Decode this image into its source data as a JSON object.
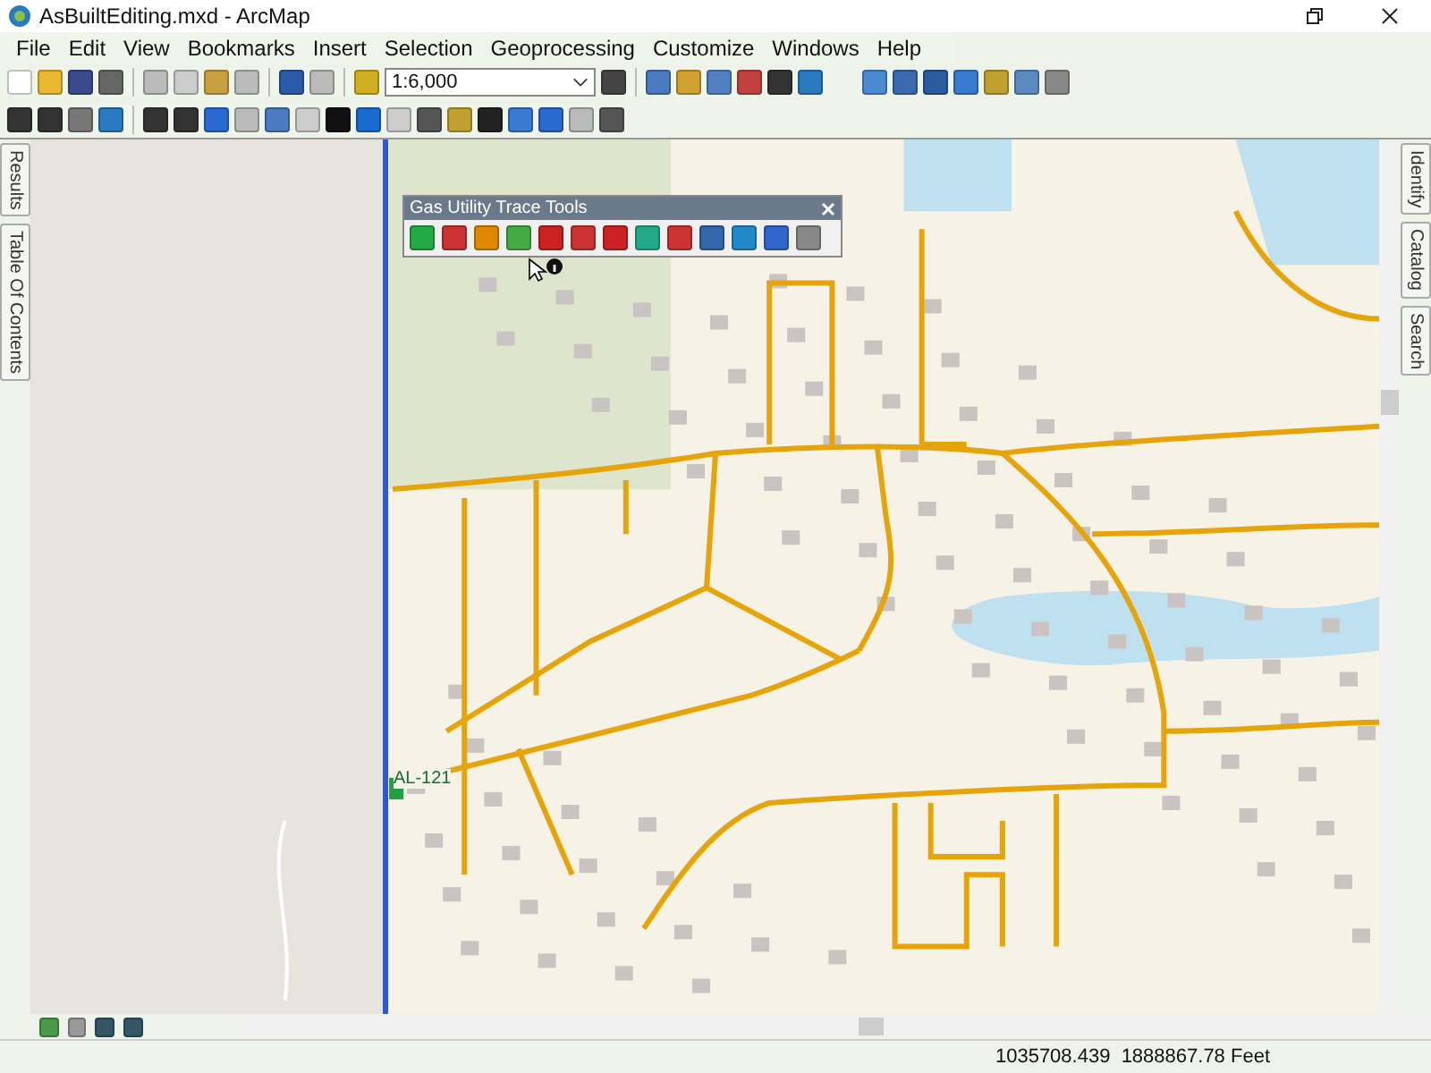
{
  "window": {
    "title": "AsBuiltEditing.mxd - ArcMap"
  },
  "menu": [
    {
      "label": "File"
    },
    {
      "label": "Edit"
    },
    {
      "label": "View"
    },
    {
      "label": "Bookmarks"
    },
    {
      "label": "Insert"
    },
    {
      "label": "Selection"
    },
    {
      "label": "Geoprocessing"
    },
    {
      "label": "Customize"
    },
    {
      "label": "Windows"
    },
    {
      "label": "Help"
    }
  ],
  "scale": {
    "value": "1:6,000"
  },
  "left_dock": [
    {
      "label": "Results"
    },
    {
      "label": "Table Of Contents"
    }
  ],
  "right_dock": [
    {
      "label": "Identify"
    },
    {
      "label": "Catalog"
    },
    {
      "label": "Search"
    }
  ],
  "trace_toolbar": {
    "title": "Gas Utility Trace Tools"
  },
  "map": {
    "label": "AL-121"
  },
  "status_bar": {
    "coordinates": "1035708.439  1888867.78 Feet"
  }
}
